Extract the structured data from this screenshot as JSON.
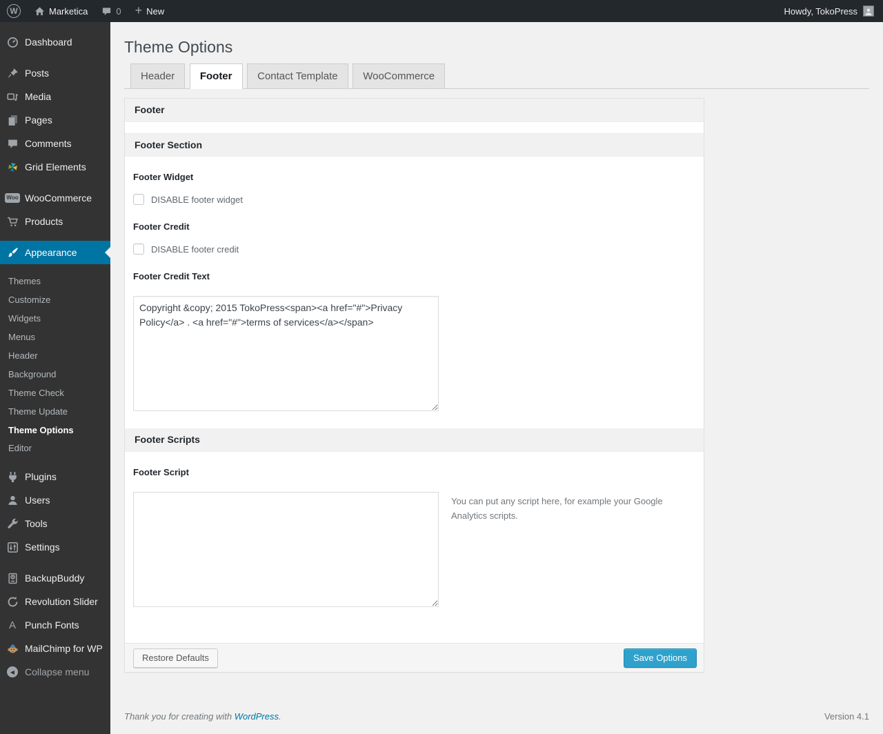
{
  "admin_bar": {
    "site_name": "Marketica",
    "comments_count": "0",
    "new_label": "New",
    "howdy": "Howdy, TokoPress"
  },
  "sidebar": {
    "items": [
      {
        "label": "Dashboard",
        "icon": "dashboard-icon"
      },
      {
        "label": "Posts",
        "icon": "pin-icon"
      },
      {
        "label": "Media",
        "icon": "media-icon"
      },
      {
        "label": "Pages",
        "icon": "pages-icon"
      },
      {
        "label": "Comments",
        "icon": "comment-icon"
      },
      {
        "label": "Grid Elements",
        "icon": "grid-elements-icon"
      },
      {
        "label": "WooCommerce",
        "icon": "woocommerce-badge-icon"
      },
      {
        "label": "Products",
        "icon": "cart-icon"
      },
      {
        "label": "Appearance",
        "icon": "brush-icon"
      },
      {
        "label": "Plugins",
        "icon": "plugin-icon"
      },
      {
        "label": "Users",
        "icon": "user-icon"
      },
      {
        "label": "Tools",
        "icon": "wrench-icon"
      },
      {
        "label": "Settings",
        "icon": "sliders-icon"
      },
      {
        "label": "BackupBuddy",
        "icon": "backup-drive-icon"
      },
      {
        "label": "Revolution Slider",
        "icon": "refresh-icon"
      },
      {
        "label": "Punch Fonts",
        "icon": "letter-a-icon"
      },
      {
        "label": "MailChimp for WP",
        "icon": "monkey-icon"
      }
    ],
    "appearance_submenu": [
      {
        "label": "Themes"
      },
      {
        "label": "Customize"
      },
      {
        "label": "Widgets"
      },
      {
        "label": "Menus"
      },
      {
        "label": "Header"
      },
      {
        "label": "Background"
      },
      {
        "label": "Theme Check"
      },
      {
        "label": "Theme Update"
      },
      {
        "label": "Theme Options",
        "current": true
      },
      {
        "label": "Editor"
      }
    ],
    "collapse_label": "Collapse menu"
  },
  "main": {
    "page_title": "Theme Options",
    "tabs": [
      {
        "label": "Header",
        "active": false
      },
      {
        "label": "Footer",
        "active": true
      },
      {
        "label": "Contact Template",
        "active": false
      },
      {
        "label": "WooCommerce",
        "active": false
      }
    ],
    "panel_title": "Footer",
    "footer_section": {
      "title": "Footer Section",
      "footer_widget_label": "Footer Widget",
      "footer_widget_checkbox": "DISABLE footer widget",
      "footer_credit_label": "Footer Credit",
      "footer_credit_checkbox": "DISABLE footer credit",
      "footer_credit_text_label": "Footer Credit Text",
      "footer_credit_text_value": "Copyright &copy; 2015 TokoPress<span><a href=\"#\">Privacy Policy</a> . <a href=\"#\">terms of services</a></span>"
    },
    "footer_scripts": {
      "title": "Footer Scripts",
      "footer_script_label": "Footer Script",
      "footer_script_value": "",
      "description": "You can put any script here, for example your Google Analytics scripts."
    },
    "actions": {
      "restore": "Restore Defaults",
      "save": "Save Options"
    }
  },
  "page_footer": {
    "thanks": "Thank you for creating with ",
    "link": "WordPress",
    "suffix": ".",
    "version": "Version 4.1"
  },
  "colors": {
    "accent": "#0074a2",
    "primary_button": "#2ea2cc",
    "admin_bar_bg": "#23282d",
    "sidebar_bg": "#333333"
  }
}
